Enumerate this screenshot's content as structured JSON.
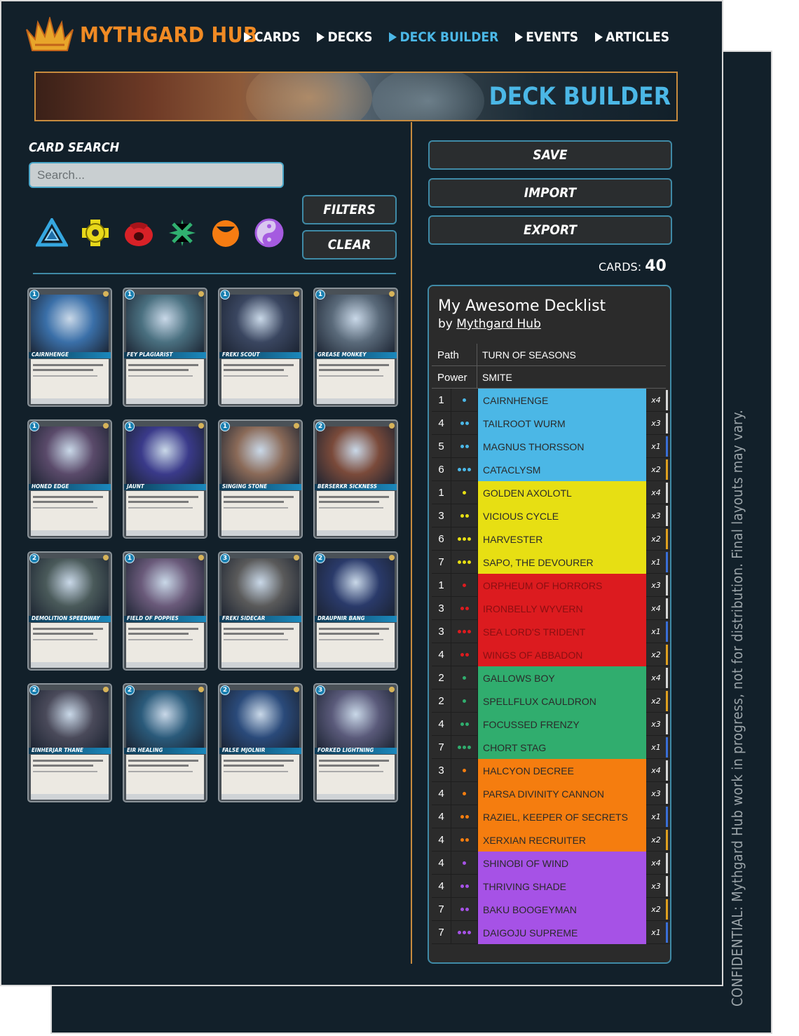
{
  "confidential": "CONFIDENTIAL:  Mythgard Hub work in progress, not for distribution. Final layouts may vary.",
  "brand": "MYTHGARD HUB",
  "nav": [
    "CARDS",
    "DECKS",
    "DECK BUILDER",
    "EVENTS",
    "ARTICLES"
  ],
  "nav_active": "DECK BUILDER",
  "banner_title": "DECK BUILDER",
  "search": {
    "label": "CARD SEARCH",
    "placeholder": "Search..."
  },
  "buttons": {
    "filters": "FILTERS",
    "clear": "CLEAR",
    "save": "SAVE",
    "import": "IMPORT",
    "export": "EXPORT"
  },
  "factions": [
    {
      "icon": "blue-triangle-knot-icon",
      "color": "#35a7e0"
    },
    {
      "icon": "yellow-gear-icon",
      "color": "#e8d81a"
    },
    {
      "icon": "red-flame-eye-icon",
      "color": "#d82127"
    },
    {
      "icon": "green-leaf-icon",
      "color": "#30b070"
    },
    {
      "icon": "orange-sun-icon",
      "color": "#f57c12"
    },
    {
      "icon": "purple-yin-yang-icon",
      "color": "#a55be0"
    }
  ],
  "cards_grid": [
    {
      "name": "CAIRNHENGE",
      "cost": "1",
      "art": "#3a6fa8"
    },
    {
      "name": "FEY PLAGIARIST",
      "cost": "1",
      "art": "#4a7080"
    },
    {
      "name": "FREKI SCOUT",
      "cost": "1",
      "art": "#3a4660"
    },
    {
      "name": "GREASE MONKEY",
      "cost": "1",
      "art": "#5a6a7a"
    },
    {
      "name": "HONED EDGE",
      "cost": "1",
      "art": "#5a4a6a"
    },
    {
      "name": "JAUNT",
      "cost": "1",
      "art": "#3a3a8a"
    },
    {
      "name": "SINGING STONE",
      "cost": "1",
      "art": "#8a6a58"
    },
    {
      "name": "BERSERKR SICKNESS",
      "cost": "2",
      "art": "#7a4a3a"
    },
    {
      "name": "DEMOLITION SPEEDWAY",
      "cost": "2",
      "art": "#4a5a5a"
    },
    {
      "name": "FIELD OF POPPIES",
      "cost": "1",
      "art": "#6a5a7a"
    },
    {
      "name": "FREKI SIDECAR",
      "cost": "3",
      "art": "#5a5a5a"
    },
    {
      "name": "DRAUPNIR BANG",
      "cost": "2",
      "art": "#2a3a6a"
    },
    {
      "name": "EINHERJAR THANE",
      "cost": "2",
      "art": "#4a4a5a"
    },
    {
      "name": "EIR HEALING",
      "cost": "2",
      "art": "#2a5a7a"
    },
    {
      "name": "FALSE MJOLNIR",
      "cost": "2",
      "art": "#2a4a7a"
    },
    {
      "name": "FORKED LIGHTNING",
      "cost": "3",
      "art": "#5a5a7a"
    }
  ],
  "cards_label": "CARDS:",
  "cards_count": "40",
  "decklist": {
    "title": "My Awesome Decklist",
    "by_label": "by",
    "author": "Mythgard Hub",
    "path_label": "Path",
    "path_value": "TURN OF SEASONS",
    "power_label": "Power",
    "power_value": "SMITE",
    "colors": {
      "blue": "#4bb7e6",
      "yellow": "#e7df13",
      "red": "#dc1b1f",
      "green": "#30ad6e",
      "orange": "#f57d0f",
      "purple": "#a652e6"
    },
    "entries": [
      {
        "cost": "1",
        "gems": 1,
        "color": "blue",
        "name": "CAIRNHENGE",
        "qty": "x4",
        "edge": "#d8d8d8"
      },
      {
        "cost": "4",
        "gems": 2,
        "color": "blue",
        "name": "TAILROOT WURM",
        "qty": "x3",
        "edge": "#d8d8d8"
      },
      {
        "cost": "5",
        "gems": 2,
        "color": "blue",
        "name": "MAGNUS THORSSON",
        "qty": "x1",
        "edge": "#3a6fd8"
      },
      {
        "cost": "6",
        "gems": 3,
        "color": "blue",
        "name": "CATACLYSM",
        "qty": "x2",
        "edge": "#e0a020"
      },
      {
        "cost": "1",
        "gems": 1,
        "color": "yellow",
        "name": "GOLDEN AXOLOTL",
        "qty": "x4",
        "edge": "#d8d8d8"
      },
      {
        "cost": "3",
        "gems": 2,
        "color": "yellow",
        "name": "VICIOUS CYCLE",
        "qty": "x3",
        "edge": "#d8d8d8"
      },
      {
        "cost": "6",
        "gems": 3,
        "color": "yellow",
        "name": "HARVESTER",
        "qty": "x2",
        "edge": "#e0a020"
      },
      {
        "cost": "7",
        "gems": 3,
        "color": "yellow",
        "name": "SAPO, THE DEVOURER",
        "qty": "x1",
        "edge": "#3a6fd8"
      },
      {
        "cost": "1",
        "gems": 1,
        "color": "red",
        "name": "ORPHEUM OF HORRORS",
        "qty": "x3",
        "edge": "#d8d8d8"
      },
      {
        "cost": "3",
        "gems": 2,
        "color": "red",
        "name": "IRONBELLY WYVERN",
        "qty": "x4",
        "edge": "#d8d8d8"
      },
      {
        "cost": "3",
        "gems": 3,
        "color": "red",
        "name": "SEA LORD'S TRIDENT",
        "qty": "x1",
        "edge": "#3a6fd8"
      },
      {
        "cost": "4",
        "gems": 2,
        "color": "red",
        "name": "WINGS OF ABBADON",
        "qty": "x2",
        "edge": "#e0a020"
      },
      {
        "cost": "2",
        "gems": 1,
        "color": "green",
        "name": "GALLOWS BOY",
        "qty": "x4",
        "edge": "#d8d8d8"
      },
      {
        "cost": "2",
        "gems": 1,
        "color": "green",
        "name": "SPELLFLUX CAULDRON",
        "qty": "x2",
        "edge": "#e0a020"
      },
      {
        "cost": "4",
        "gems": 2,
        "color": "green",
        "name": "FOCUSSED FRENZY",
        "qty": "x3",
        "edge": "#d8d8d8"
      },
      {
        "cost": "7",
        "gems": 3,
        "color": "green",
        "name": "CHORT STAG",
        "qty": "x1",
        "edge": "#3a6fd8"
      },
      {
        "cost": "3",
        "gems": 1,
        "color": "orange",
        "name": "HALCYON DECREE",
        "qty": "x4",
        "edge": "#d8d8d8"
      },
      {
        "cost": "4",
        "gems": 1,
        "color": "orange",
        "name": "PARSA DIVINITY CANNON",
        "qty": "x3",
        "edge": "#d8d8d8"
      },
      {
        "cost": "4",
        "gems": 2,
        "color": "orange",
        "name": "RAZIEL, KEEPER OF SECRETS",
        "qty": "x1",
        "edge": "#3a6fd8"
      },
      {
        "cost": "4",
        "gems": 2,
        "color": "orange",
        "name": "XERXIAN RECRUITER",
        "qty": "x2",
        "edge": "#e0a020"
      },
      {
        "cost": "4",
        "gems": 1,
        "color": "purple",
        "name": "SHINOBI OF WIND",
        "qty": "x4",
        "edge": "#d8d8d8"
      },
      {
        "cost": "4",
        "gems": 2,
        "color": "purple",
        "name": "THRIVING SHADE",
        "qty": "x3",
        "edge": "#d8d8d8"
      },
      {
        "cost": "7",
        "gems": 2,
        "color": "purple",
        "name": "BAKU BOOGEYMAN",
        "qty": "x2",
        "edge": "#e0a020"
      },
      {
        "cost": "7",
        "gems": 3,
        "color": "purple",
        "name": "DAIGOJU SUPREME",
        "qty": "x1",
        "edge": "#3a6fd8"
      }
    ]
  }
}
